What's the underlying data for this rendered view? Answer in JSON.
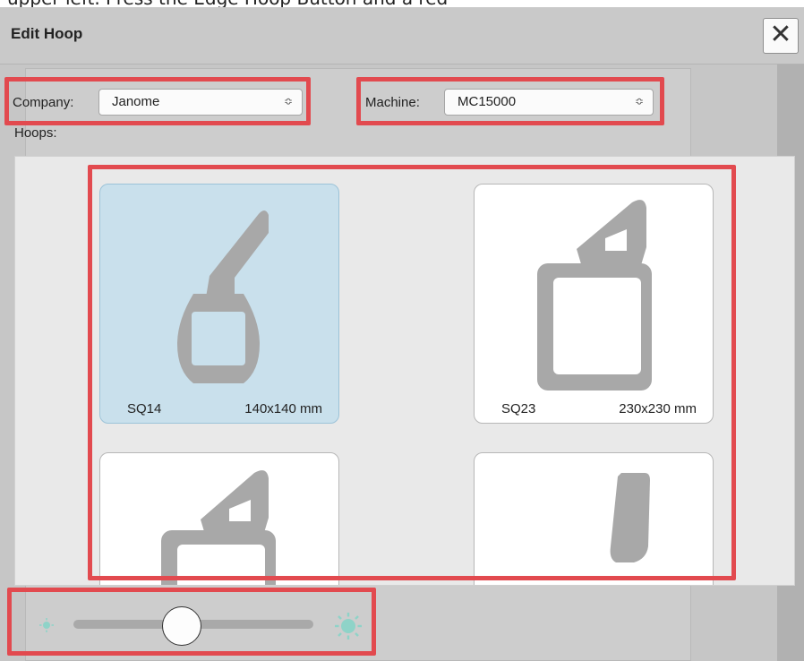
{
  "page_top_text": "upper left. Press the Edge Hoop Button and a red",
  "dialog": {
    "title": "Edit Hoop",
    "close_label": "✕"
  },
  "company": {
    "label": "Company:",
    "value": "Janome"
  },
  "machine": {
    "label": "Machine:",
    "value": "MC15000"
  },
  "hoops_label": "Hoops:",
  "hoops": [
    {
      "name": "SQ14",
      "size": "140x140 mm",
      "selected": true
    },
    {
      "name": "SQ23",
      "size": "230x230 mm",
      "selected": false
    },
    {
      "name": "",
      "size": "",
      "selected": false
    },
    {
      "name": "",
      "size": "",
      "selected": false
    }
  ],
  "zoom_slider": {
    "level": 0.45
  },
  "colors": {
    "highlight": "#e24a4f",
    "selected_card": "#c9e0ec",
    "hoop_shape": "#a8a8a8",
    "sun_icon": "#8fd3c8"
  },
  "icons": {
    "close": "close-icon",
    "select": "chevron-updown-icon",
    "zoom_out": "sun-small-icon",
    "zoom_in": "sun-large-icon"
  }
}
